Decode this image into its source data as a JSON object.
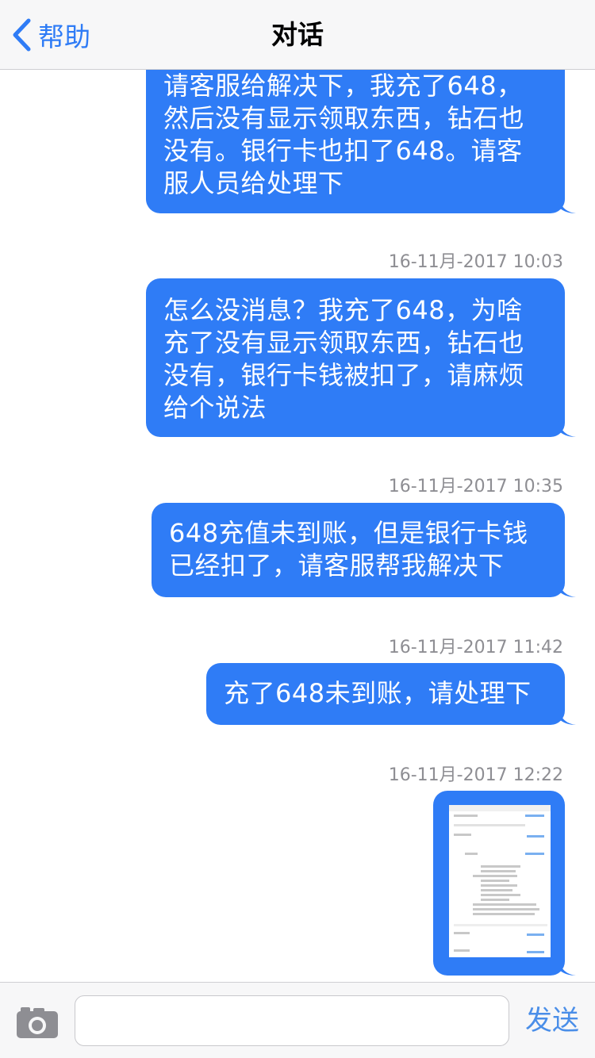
{
  "nav": {
    "back_label": "帮助",
    "title": "对话"
  },
  "messages": [
    {
      "lines": [
        "请客服给解决下，我充了648，",
        "然后没有显示领取东西，钻石也",
        "没有。银行卡也扣了648。请客",
        "服人员给处理下"
      ]
    },
    {
      "timestamp": "16-11月-2017 10:03",
      "lines": [
        "怎么没消息？我充了648，为啥",
        "充了没有显示领取东西，钻石也",
        "没有，银行卡钱被扣了，请麻烦",
        "给个说法"
      ]
    },
    {
      "timestamp": "16-11月-2017 10:35",
      "lines": [
        "648充值未到账，但是银行卡钱",
        "已经扣了，请客服帮我解决下"
      ]
    },
    {
      "timestamp": "16-11月-2017 11:42",
      "lines": [
        "充了648未到账，请处理下"
      ]
    },
    {
      "timestamp": "16-11月-2017 12:22",
      "image": "screenshot-thumbnail"
    }
  ],
  "input": {
    "placeholder": "",
    "value": "",
    "send_label": "发送",
    "camera_icon": "camera-icon"
  },
  "colors": {
    "accent": "#2f7cf6",
    "bubble_text": "#ffffff",
    "timestamp": "#8e8e93",
    "bar_bg": "#f7f7f8"
  }
}
